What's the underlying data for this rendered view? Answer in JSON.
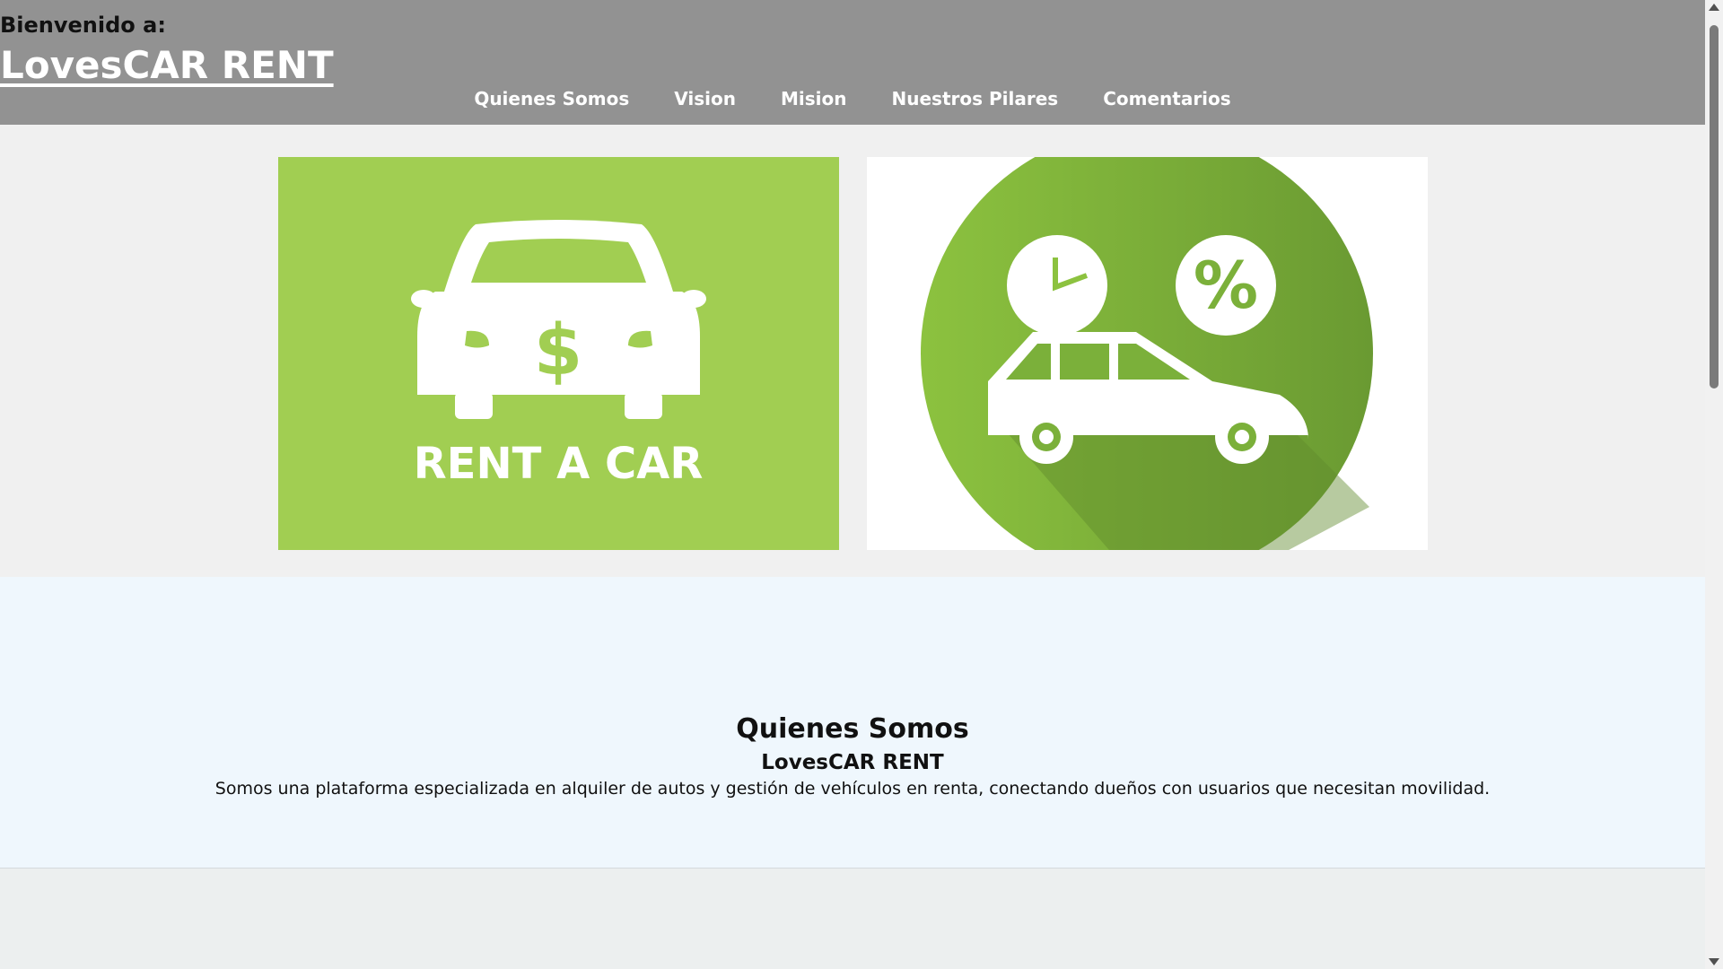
{
  "header": {
    "welcome": "Bienvenido a:",
    "brand": "LovesCAR RENT"
  },
  "nav": {
    "items": [
      "Quienes Somos",
      "Vision",
      "Mision",
      "Nuestros Pilares",
      "Comentarios"
    ]
  },
  "hero": {
    "left_card_caption": "RENT A CAR",
    "left_card_symbol": "$",
    "right_card_symbol": "%",
    "icons": [
      "car-dollar-icon",
      "car-clock-percent-icon"
    ]
  },
  "about": {
    "title": "Quienes Somos",
    "subtitle": "LovesCAR RENT",
    "description": "Somos una plataforma especializada en alquiler de autos y gestión de vehículos en renta, conectando dueños con usuarios que necesitan movilidad."
  },
  "colors": {
    "header_bg": "#929292",
    "accent_green": "#a1ce52",
    "about_bg": "#eff7fd"
  }
}
